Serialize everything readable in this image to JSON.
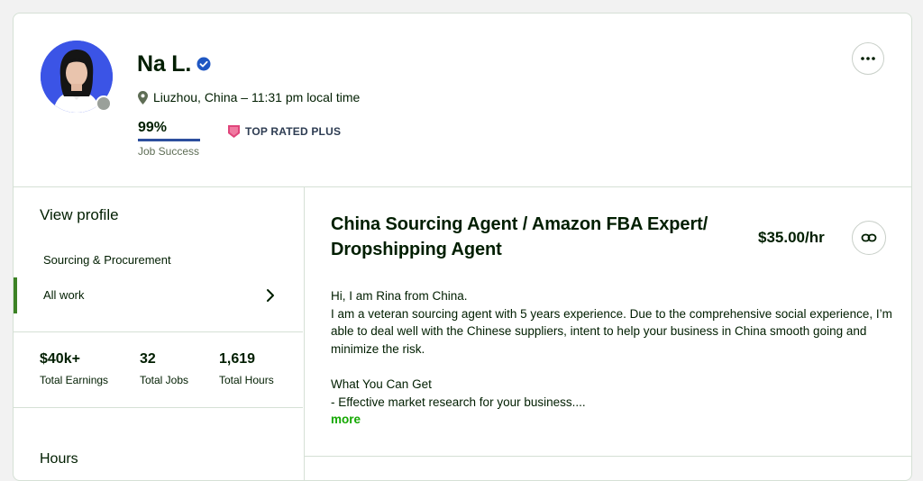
{
  "profile": {
    "name": "Na L.",
    "location": "Liuzhou, China – 11:31 pm local time",
    "job_success_value": "99%",
    "job_success_label": "Job Success",
    "badge": "TOP RATED PLUS",
    "job_success_fraction": 0.99
  },
  "sidebar": {
    "view_profile": "View profile",
    "category": "Sourcing & Procurement",
    "all_work": "All work",
    "stats": [
      {
        "value": "$40k+",
        "label": "Total Earnings"
      },
      {
        "value": "32",
        "label": "Total Jobs"
      },
      {
        "value": "1,619",
        "label": "Total Hours"
      }
    ],
    "hours_label": "Hours"
  },
  "main": {
    "title": "China Sourcing Agent / Amazon FBA Expert/ Dropshipping Agent",
    "rate": "$35.00/hr",
    "overview_lines": [
      "Hi, I am Rina from China.",
      "I am a veteran sourcing agent with 5 years experience. Due to the comprehensive social experience, I’m able to deal well with the Chinese suppliers, intent to help your business in China smooth going and minimize the risk.",
      "",
      "What You Can Get",
      "- Effective market research for your business...."
    ],
    "more_label": "more"
  },
  "colors": {
    "accent_green": "#14a800",
    "indicator_green": "#3c8224",
    "verified_blue": "#1f57c3",
    "badge_pink": "#e0457b"
  },
  "icons": [
    "avatar",
    "verified-icon",
    "location-pin-icon",
    "top-rated-plus-icon",
    "more-options-icon",
    "chevron-right-icon",
    "link-icon"
  ]
}
